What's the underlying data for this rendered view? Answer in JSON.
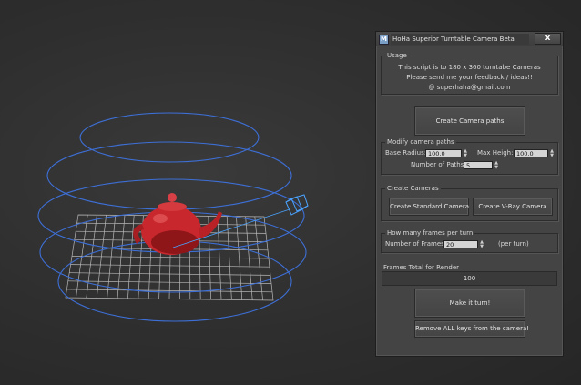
{
  "dialog": {
    "title": "HoHa Superior Turntable Camera Beta",
    "icon_letter": "M",
    "close_symbol": "x"
  },
  "usage": {
    "label": "Usage",
    "line1": "This script is to 180 x 360 turntabe Cameras",
    "line2": "Please send me your feedback / ideas!!",
    "line3": "@ superhaha@gmail.com"
  },
  "create_paths": {
    "button": "Create Camera paths"
  },
  "modify": {
    "label": "Modify camera paths",
    "base_radius_label": "Base Radius:",
    "base_radius_value": "100.0",
    "max_height_label": "Max Heigh:",
    "max_height_value": "100.0",
    "num_paths_label": "Number of Paths:",
    "num_paths_value": "5"
  },
  "cameras": {
    "label": "Create Cameras",
    "standard_button": "Create Standard Camera",
    "vray_button": "Create V-Ray Camera"
  },
  "frames_per_turn": {
    "label": "How many frames per turn",
    "num_frames_label": "Number of Frames:",
    "num_frames_value": "20",
    "suffix": "(per turn)"
  },
  "frames_total": {
    "label": "Frames Total for Render",
    "value": "100"
  },
  "actions": {
    "make_turn": "Make it turn!",
    "remove_keys": "Remove ALL keys from the camera!"
  },
  "viewport": {
    "colors": {
      "path": "#3d6fd6",
      "grid": "#d8d8d8",
      "teapot": "#c2262b",
      "camera": "#4aa3ff"
    },
    "icons": [
      "camera-gizmo-icon"
    ]
  }
}
